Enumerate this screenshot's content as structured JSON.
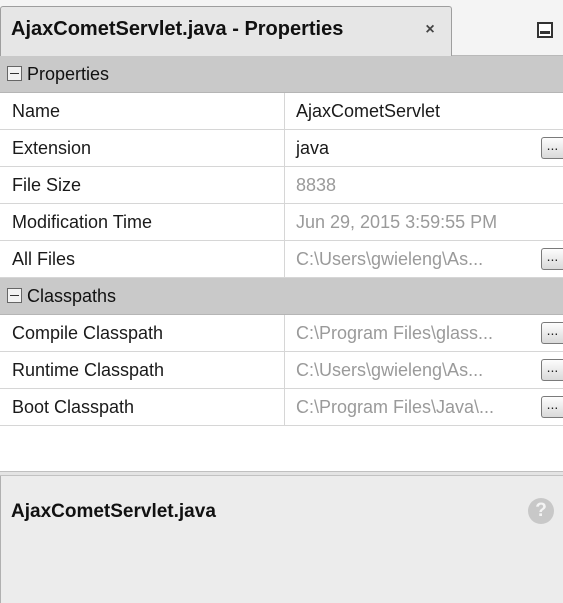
{
  "window": {
    "tab_title": "AjaxCometServlet.java - Properties",
    "close_glyph": "×",
    "icons": [
      "close-icon",
      "minimize-icon"
    ]
  },
  "sections": [
    {
      "label": "Properties",
      "rows": [
        {
          "name": "Name",
          "value": "AjaxCometServlet",
          "editable": true,
          "has_button": false
        },
        {
          "name": "Extension",
          "value": "java",
          "editable": true,
          "has_button": true
        },
        {
          "name": "File Size",
          "value": "8838",
          "editable": false,
          "has_button": false
        },
        {
          "name": "Modification Time",
          "value": "Jun 29, 2015 3:59:55 PM",
          "editable": false,
          "has_button": false
        },
        {
          "name": "All Files",
          "value": "C:\\Users\\gwieleng\\As...",
          "editable": false,
          "has_button": true
        }
      ]
    },
    {
      "label": "Classpaths",
      "rows": [
        {
          "name": "Compile Classpath",
          "value": "C:\\Program Files\\glass...",
          "editable": false,
          "has_button": true
        },
        {
          "name": "Runtime Classpath",
          "value": "C:\\Users\\gwieleng\\As...",
          "editable": false,
          "has_button": true
        },
        {
          "name": "Boot Classpath",
          "value": "C:\\Program Files\\Java\\...",
          "editable": false,
          "has_button": true
        }
      ]
    }
  ],
  "ellipsis_label": "...",
  "description": {
    "title": "AjaxCometServlet.java",
    "help_glyph": "?"
  },
  "colors": {
    "section_header": "#c9c9c9",
    "readonly_text": "#9a9a9a",
    "description_bg": "#ececec"
  }
}
